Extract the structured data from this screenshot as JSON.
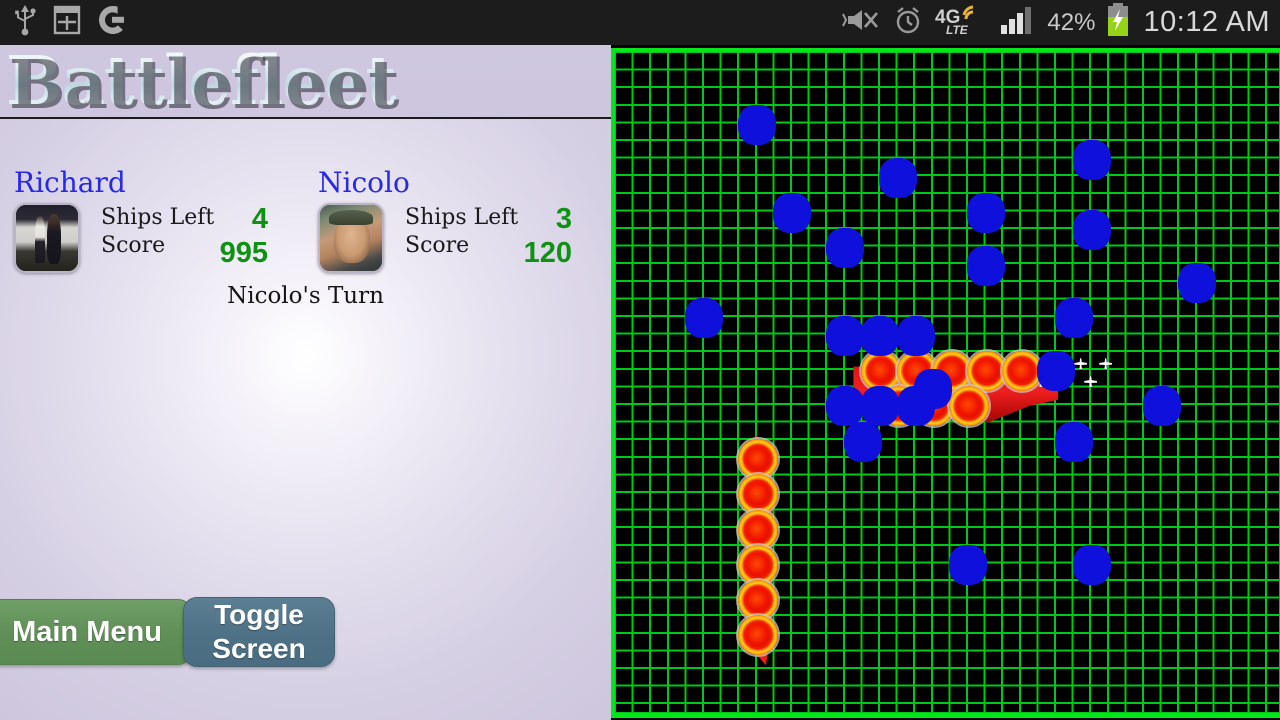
{
  "statusbar": {
    "left_icons": [
      "usb-icon",
      "screenshot-icon",
      "google-icon"
    ],
    "right_icons": [
      "mute-vibrate-icon",
      "alarm-icon",
      "4g-lte-icon",
      "signal-bars-icon",
      "battery-charging-icon"
    ],
    "battery_percent": "42%",
    "network": "4G",
    "network_sub": "LTE",
    "clock": "10:12 AM"
  },
  "app": {
    "title": "Battlefleet"
  },
  "players": [
    {
      "name": "Richard",
      "avatar": "richard-avatar",
      "ships_label": "Ships Left",
      "ships_value": "4",
      "score_label": "Score",
      "score_value": "995"
    },
    {
      "name": "Nicolo",
      "avatar": "nicolo-avatar",
      "ships_label": "Ships Left",
      "ships_value": "3",
      "score_label": "Score",
      "score_value": "120"
    }
  ],
  "turn_text": "Nicolo's Turn",
  "buttons": {
    "main_menu": "Main Menu",
    "toggle_line1": "Toggle",
    "toggle_line2": "Screen"
  },
  "colors": {
    "accent_green": "#0f9214",
    "player_name_blue": "#2828e8",
    "grid_border": "#00e61a",
    "grid_line": "#00c814",
    "miss_marker": "#1010dd",
    "ship_red": "#e81414",
    "panel_lavender": "#cdc6dd",
    "statusbar_bg": "#1c1c1c",
    "btn_green": "#5f8f57",
    "btn_blue": "#4f7186"
  },
  "board": {
    "cell_size": 17.6,
    "cols": 38,
    "rows": 38,
    "misses": [
      [
        7,
        3
      ],
      [
        9,
        8
      ],
      [
        15,
        6
      ],
      [
        12,
        10
      ],
      [
        20,
        11
      ],
      [
        26,
        5
      ],
      [
        32,
        12
      ],
      [
        4,
        14
      ],
      [
        12,
        15
      ],
      [
        14,
        15
      ],
      [
        16,
        15
      ],
      [
        17,
        18
      ],
      [
        12,
        19
      ],
      [
        14,
        19
      ],
      [
        16,
        19
      ],
      [
        25,
        14
      ],
      [
        30,
        19
      ],
      [
        20,
        8
      ],
      [
        26,
        9
      ],
      [
        25,
        21
      ],
      [
        19,
        28
      ],
      [
        26,
        28
      ],
      [
        13,
        21
      ],
      [
        24,
        17
      ]
    ],
    "ships": [
      {
        "id": "carrier-horizontal",
        "orientation": "horizontal",
        "destroyed": true,
        "hits": [
          [
            14,
            17
          ],
          [
            16,
            17
          ],
          [
            18,
            17
          ],
          [
            20,
            17
          ],
          [
            22,
            17
          ],
          [
            15,
            19
          ],
          [
            17,
            19
          ],
          [
            19,
            19
          ]
        ],
        "planes": 7
      },
      {
        "id": "cruiser-vertical",
        "orientation": "vertical",
        "destroyed": true,
        "hits": [
          [
            7,
            22
          ],
          [
            7,
            24
          ],
          [
            7,
            26
          ],
          [
            7,
            28
          ],
          [
            7,
            30
          ],
          [
            7,
            32
          ]
        ]
      }
    ]
  }
}
